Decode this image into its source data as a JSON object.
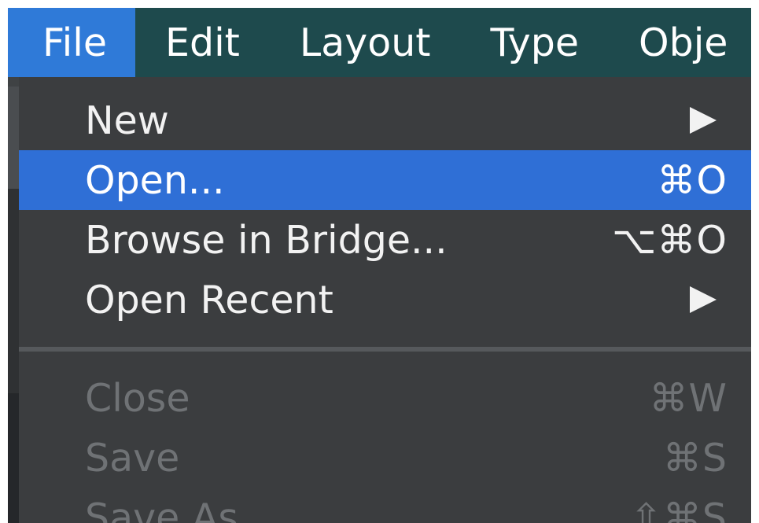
{
  "menubar": {
    "items": [
      {
        "label": "File",
        "active": true
      },
      {
        "label": "Edit"
      },
      {
        "label": "Layout"
      },
      {
        "label": "Type"
      },
      {
        "label": "Obje"
      }
    ]
  },
  "file_menu": {
    "items": [
      {
        "label": "New",
        "submenu": true,
        "icon": "submenu-arrow-icon"
      },
      {
        "label": "Open...",
        "shortcut": "⌘O",
        "highlighted": true
      },
      {
        "label": "Browse in Bridge...",
        "shortcut": "⌥⌘O"
      },
      {
        "label": "Open Recent",
        "submenu": true,
        "icon": "submenu-arrow-icon"
      },
      {
        "label": "Close",
        "shortcut": "⌘W",
        "disabled": true
      },
      {
        "label": "Save",
        "shortcut": "⌘S",
        "disabled": true
      },
      {
        "label": "Save As",
        "shortcut": "⇧⌘S",
        "disabled": true
      }
    ]
  },
  "colors": {
    "menubar_bg": "#1e4a4d",
    "active_menubar_item": "#2f7ad8",
    "menu_bg": "#3b3d3f",
    "highlight": "#2f6fd6",
    "disabled_text": "#6f7275"
  }
}
